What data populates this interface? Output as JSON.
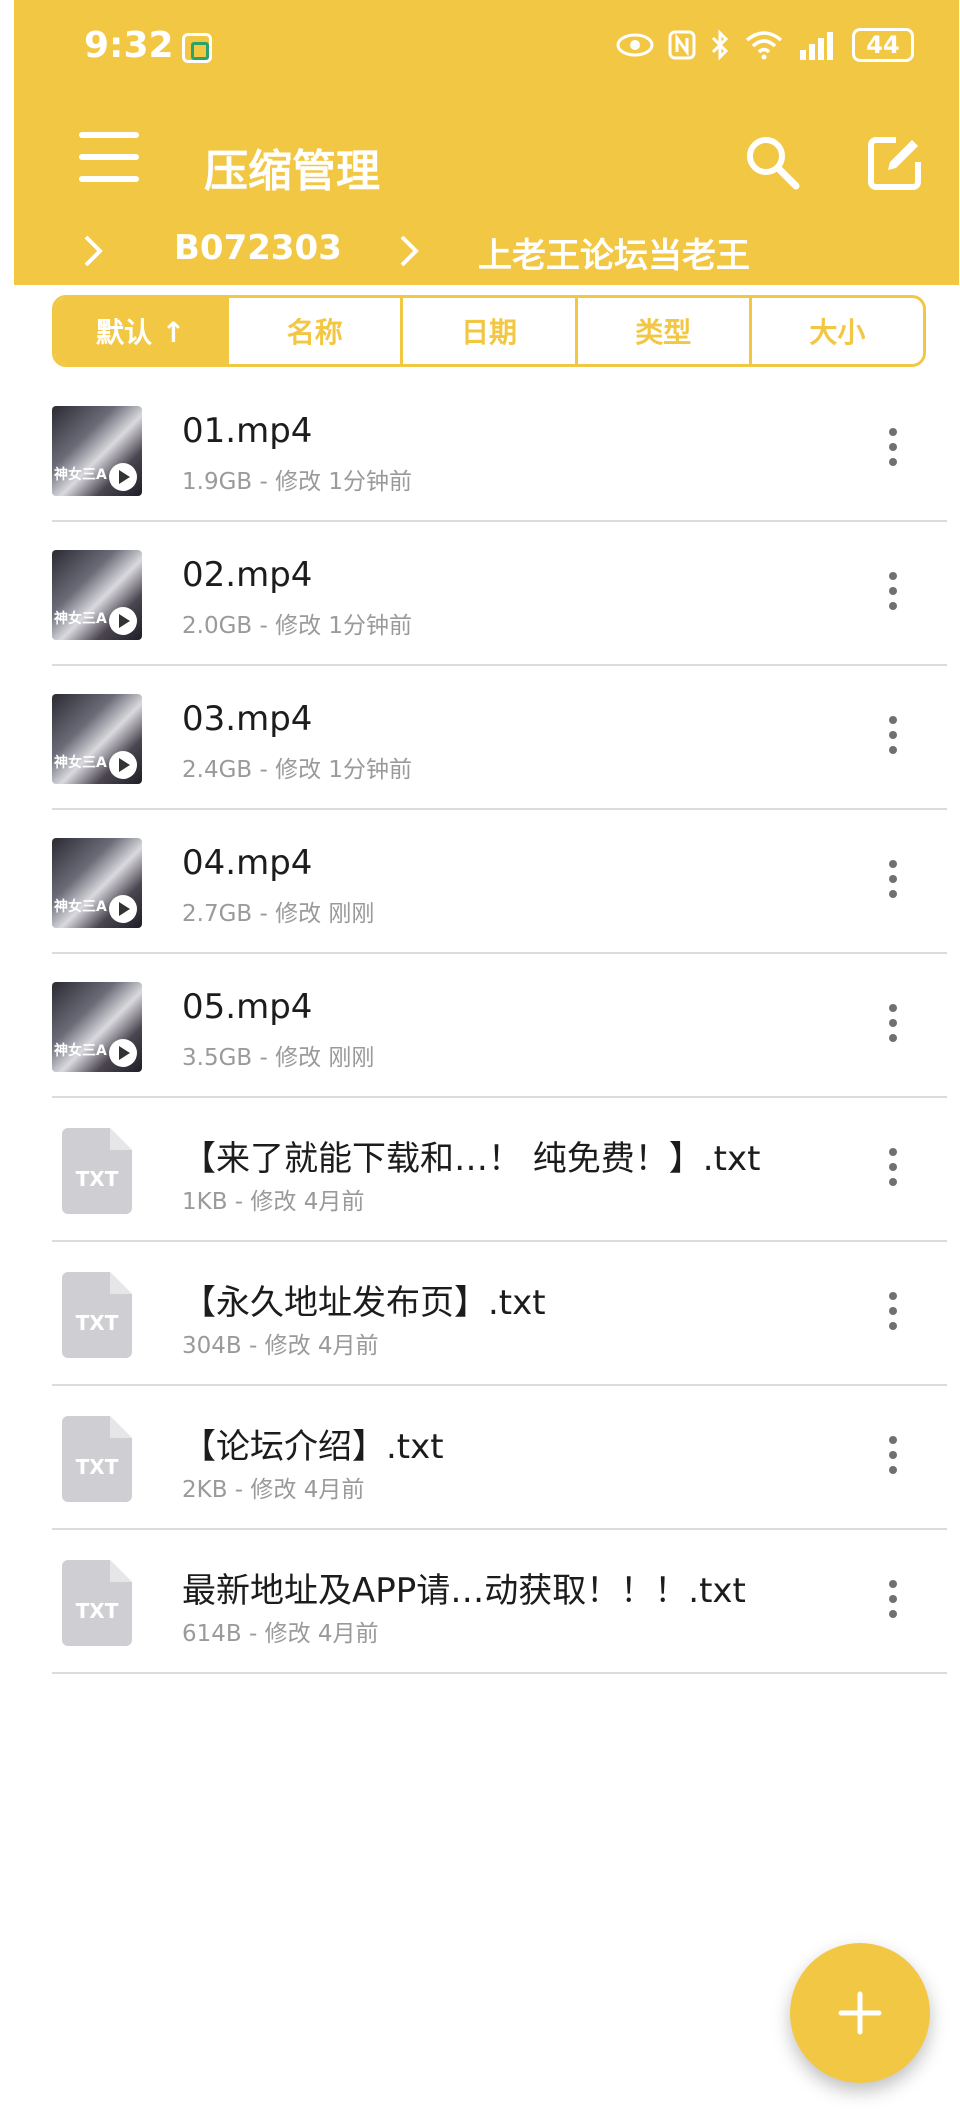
{
  "status_bar": {
    "time": "9:32",
    "battery": "44"
  },
  "toolbar": {
    "title": "压缩管理"
  },
  "breadcrumb": {
    "items": [
      "B072303",
      "上老王论坛当老王"
    ]
  },
  "sort_tabs": [
    {
      "label": "默认 ↑",
      "active": true
    },
    {
      "label": "名称",
      "active": false
    },
    {
      "label": "日期",
      "active": false
    },
    {
      "label": "类型",
      "active": false
    },
    {
      "label": "大小",
      "active": false
    }
  ],
  "thumb_label": "神女三A",
  "txt_icon_label": "TXT",
  "files": [
    {
      "name": "01.mp4",
      "meta": "1.9GB - 修改 1分钟前",
      "kind": "video"
    },
    {
      "name": "02.mp4",
      "meta": "2.0GB - 修改 1分钟前",
      "kind": "video"
    },
    {
      "name": "03.mp4",
      "meta": "2.4GB - 修改 1分钟前",
      "kind": "video"
    },
    {
      "name": "04.mp4",
      "meta": "2.7GB - 修改 刚刚",
      "kind": "video"
    },
    {
      "name": "05.mp4",
      "meta": "3.5GB - 修改 刚刚",
      "kind": "video"
    },
    {
      "name": "【来了就能下载和…！ 纯免费！】.txt",
      "meta": "1KB - 修改 4月前",
      "kind": "txt"
    },
    {
      "name": "【永久地址发布页】.txt",
      "meta": "304B - 修改 4月前",
      "kind": "txt"
    },
    {
      "name": "【论坛介绍】.txt",
      "meta": "2KB - 修改 4月前",
      "kind": "txt"
    },
    {
      "name": "最新地址及APP请…动获取！！！.txt",
      "meta": "614B - 修改 4月前",
      "kind": "txt"
    }
  ],
  "colors": {
    "accent": "#f2c744",
    "text": "#1c1c1c",
    "meta": "#9a9a9a",
    "divider": "#dcdcdc"
  }
}
